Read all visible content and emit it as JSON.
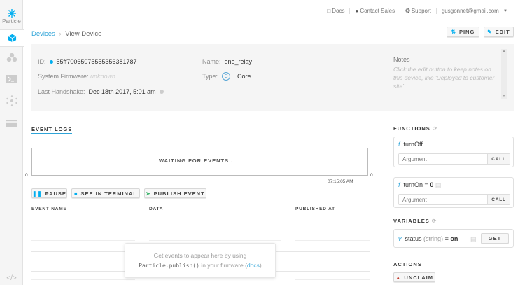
{
  "sidebar": {
    "logo_label": "Particle",
    "items": [
      "devices",
      "integrations",
      "console",
      "mesh-network",
      "billing",
      "sdk-code"
    ]
  },
  "header": {
    "docs": "Docs",
    "contact_sales": "Contact Sales",
    "support": "Support",
    "account": "gusgonnet@gmail.com"
  },
  "breadcrumb": {
    "root": "Devices",
    "current": "View Device"
  },
  "actions": {
    "ping": "PING",
    "edit": "EDIT"
  },
  "device": {
    "id_label": "ID:",
    "id": "55ff70065075555356381787",
    "online_color": "#00aeef",
    "name_label": "Name:",
    "name": "one_relay",
    "firmware_label": "System Firmware:",
    "firmware": "unknown",
    "type_label": "Type:",
    "type_badge": "C",
    "type": "Core",
    "handshake_label": "Last Handshake:",
    "handshake": "Dec 18th 2017, 5:01 am"
  },
  "notes": {
    "title": "Notes",
    "placeholder": "Click the edit button to keep notes on this device, like 'Deployed to customer site'."
  },
  "event_logs": {
    "tab": "EVENT LOGS",
    "waiting": "WAITING FOR EVENTS .",
    "y_left": "0",
    "y_right": "0",
    "time_tick": "07:15:05 AM",
    "pause": "PAUSE",
    "terminal": "SEE IN TERMINAL",
    "publish": "PUBLISH EVENT",
    "columns": [
      "EVENT NAME",
      "DATA",
      "PUBLISHED AT"
    ],
    "empty_line1": "Get events to appear here by using",
    "empty_code": "Particle.publish()",
    "empty_mid": " in your firmware (",
    "empty_link": "docs",
    "empty_end": ")"
  },
  "functions": {
    "title": "FUNCTIONS",
    "items": [
      {
        "name": "turnOff",
        "result": "",
        "placeholder": "Argument",
        "call": "CALL"
      },
      {
        "name": "turnOn = ",
        "result": "0",
        "placeholder": "Argument",
        "call": "CALL"
      }
    ]
  },
  "variables": {
    "title": "VARIABLES",
    "items": [
      {
        "name": "status",
        "type": "(string)",
        "eq": "=",
        "value": "on",
        "get": "GET"
      }
    ]
  },
  "actions_section": {
    "title": "ACTIONS",
    "unclaim": "UNCLAIM"
  },
  "colors": {
    "accent": "#00aeef",
    "danger": "#c0392b"
  }
}
